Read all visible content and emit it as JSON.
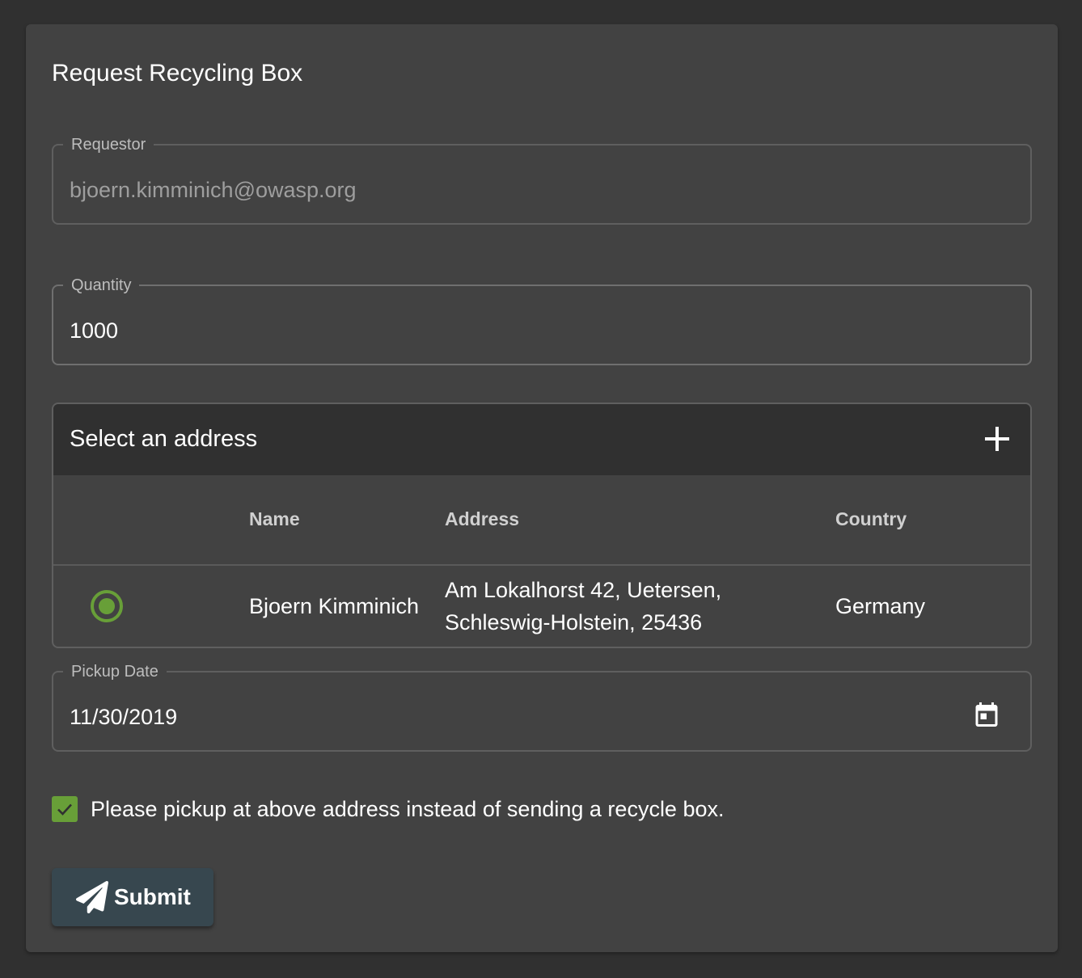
{
  "form": {
    "title": "Request Recycling Box",
    "requestor": {
      "label": "Requestor",
      "value": "bjoern.kimminich@owasp.org"
    },
    "quantity": {
      "label": "Quantity",
      "value": "1000"
    },
    "address_panel": {
      "title": "Select an address",
      "add_icon": "plus-icon",
      "columns": [
        "Name",
        "Address",
        "Country"
      ],
      "rows": [
        {
          "selected": true,
          "name": "Bjoern Kimminich",
          "address_line1": "Am Lokalhorst 42, Uetersen,",
          "address_line2": "Schleswig-Holstein, 25436",
          "country": "Germany"
        }
      ]
    },
    "pickup_date": {
      "label": "Pickup Date",
      "value": "11/30/2019",
      "icon": "calendar-icon"
    },
    "pickup_checkbox": {
      "checked": true,
      "label": "Please pickup at above address instead of sending a recycle box."
    },
    "submit": {
      "label": "Submit",
      "icon": "paper-plane-icon"
    }
  },
  "colors": {
    "page_background": "#303030",
    "card_background": "#424242",
    "accent_green": "#689f38",
    "button_background": "#37474f"
  }
}
